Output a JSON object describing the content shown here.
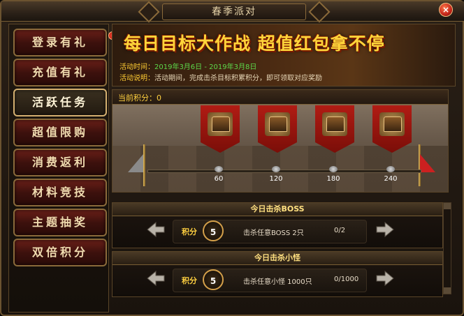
{
  "window": {
    "title": "春季派对",
    "close_label": "×"
  },
  "sidebar": {
    "items": [
      {
        "label": "登录有礼"
      },
      {
        "label": "充值有礼"
      },
      {
        "label": "活跃任务"
      },
      {
        "label": "超值限购"
      },
      {
        "label": "消费返利"
      },
      {
        "label": "材料竞技"
      },
      {
        "label": "主题抽奖"
      },
      {
        "label": "双倍积分"
      }
    ],
    "active_index": 2
  },
  "banner": {
    "title": "每日目标大作战  超值红包拿不停",
    "time_label": "活动时间：",
    "time_value": "2019年3月6日 - 2019年3月8日",
    "desc_label": "活动说明：",
    "desc_value": "活动期间，完成击杀目标积累积分，即可领取对应奖励"
  },
  "progress": {
    "current_label": "当前积分：0",
    "current_points": 0,
    "milestones": [
      {
        "label": "60"
      },
      {
        "label": "120"
      },
      {
        "label": "180"
      },
      {
        "label": "240"
      }
    ]
  },
  "tasks": [
    {
      "header": "今日击杀BOSS",
      "score_label": "积分",
      "score": "5",
      "desc": "击杀任意BOSS 2只",
      "progress": "0/2"
    },
    {
      "header": "今日击杀小怪",
      "score_label": "积分",
      "score": "5",
      "desc": "击杀任意小怪 1000只",
      "progress": "0/1000"
    }
  ],
  "colors": {
    "accent_gold": "#ffd040",
    "active_red": "#6a1f18",
    "banner_yellow": "#ffd53a",
    "time_green": "#5cd84a"
  }
}
